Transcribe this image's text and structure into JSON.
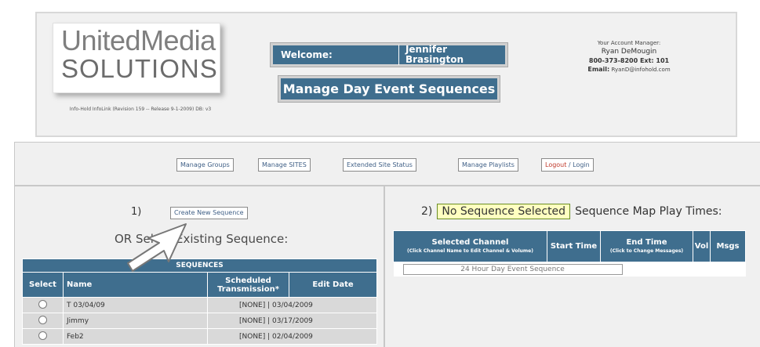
{
  "header": {
    "logo": {
      "line1": "UnitedMedia",
      "line2": "SOLUTIONS"
    },
    "revision": "Info-Hold InfoLink (Revision 159 -- Release 9-1-2009) DB: v3",
    "welcome_label": "Welcome:",
    "user_name": "Jennifer Brasington",
    "page_title": "Manage Day Event Sequences",
    "account_manager": {
      "title": "Your Account Manager:",
      "name": "Ryan DeMougin",
      "phone": "800-373-8200 Ext: 101",
      "email_label": "Email:",
      "email": "RyanD@infohold.com"
    }
  },
  "nav": {
    "manage_groups": "Manage Groups",
    "manage_sites": "Manage SITES",
    "extended_site_status": "Extended Site Status",
    "manage_playlists": "Manage Playlists",
    "logout": "Logout",
    "login": " / Login"
  },
  "left": {
    "step_number": "1)",
    "create_button": "Create New Sequence",
    "or_select": "OR Select Existing Sequence:",
    "table": {
      "caption": "SEQUENCES",
      "columns": [
        "Select",
        "Name",
        "Scheduled Transmission*",
        "Edit Date"
      ],
      "rows": [
        {
          "name": "T 03/04/09",
          "scheduled": "[NONE]",
          "edit_date": "03/04/2009"
        },
        {
          "name": "Jimmy",
          "scheduled": "[NONE]",
          "edit_date": "03/17/2009"
        },
        {
          "name": "Feb2",
          "scheduled": "[NONE]",
          "edit_date": "02/04/2009"
        }
      ]
    }
  },
  "right": {
    "step_number": "2)",
    "no_sequence": "No Sequence Selected",
    "map_title": "Sequence Map Play Times:",
    "table": {
      "col_channel": "Selected Channel",
      "col_channel_sub": "(Click Channel Name to Edit Channel & Volume)",
      "col_start": "Start Time",
      "col_end": "End Time",
      "col_end_sub": "(Click to Change Messages)",
      "col_vol": "Vol",
      "col_msgs": "Msgs",
      "row_label": "24 Hour Day Event Sequence"
    }
  },
  "colors": {
    "accent": "#3f6e8e",
    "panel": "#f0f0f0",
    "highlight": "#ffffc0",
    "logout": "#c0392b"
  }
}
